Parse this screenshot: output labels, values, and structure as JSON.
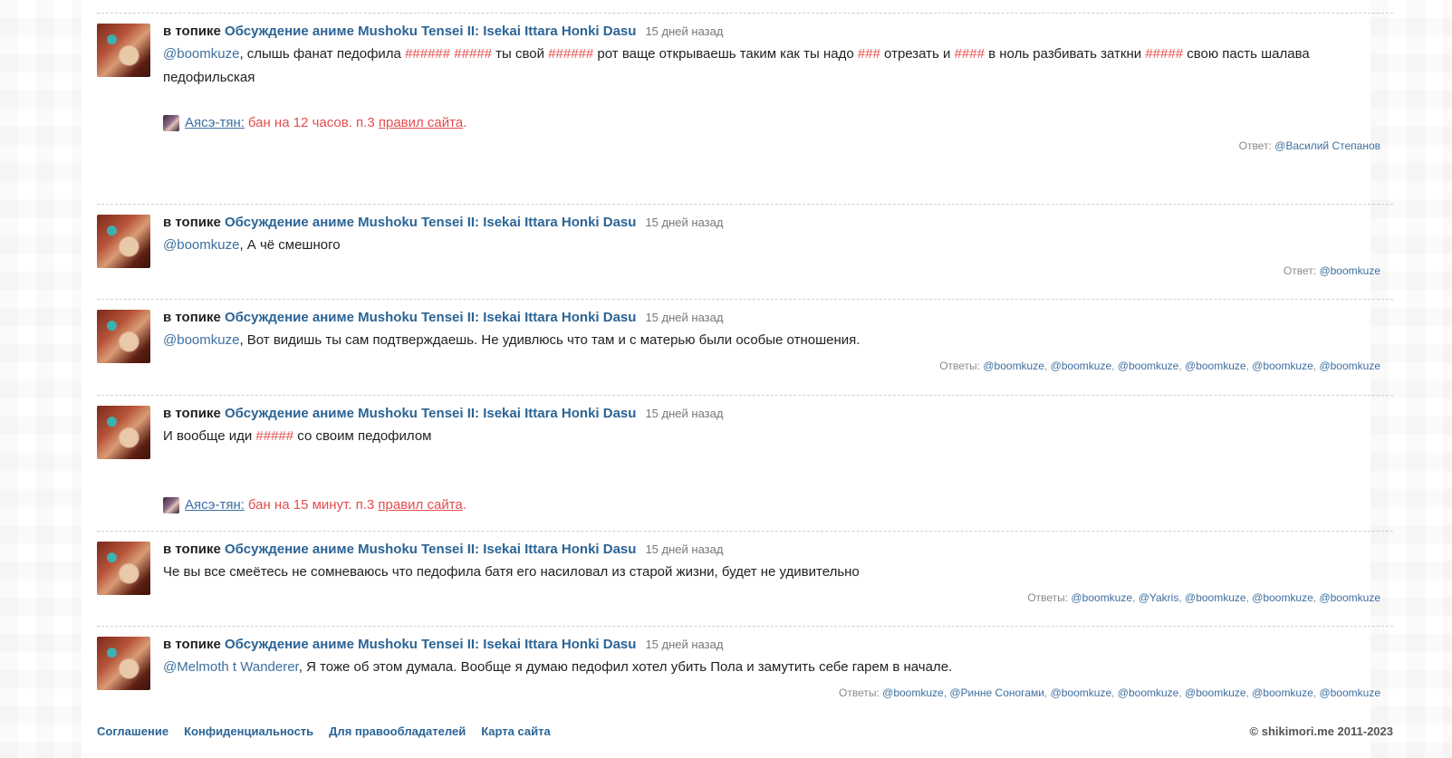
{
  "comments": [
    {
      "in_topic": "в топике",
      "topic": "Обсуждение аниме Mushoku Tensei II: Isekai Ittara Honki Dasu",
      "time": "15 дней назад",
      "parts": [
        {
          "t": "mention",
          "v": "@boomkuze"
        },
        {
          "t": "text",
          "v": ", слышь фанат педофила "
        },
        {
          "t": "censor",
          "v": "######"
        },
        {
          "t": "text",
          "v": " "
        },
        {
          "t": "censor",
          "v": "#####"
        },
        {
          "t": "text",
          "v": " ты свой "
        },
        {
          "t": "censor",
          "v": "######"
        },
        {
          "t": "text",
          "v": " рот ваще открываешь таким как ты надо "
        },
        {
          "t": "censor",
          "v": "###"
        },
        {
          "t": "text",
          "v": " отрезать и "
        },
        {
          "t": "censor",
          "v": "####"
        },
        {
          "t": "text",
          "v": " в ноль разбивать заткни "
        },
        {
          "t": "censor",
          "v": "#####"
        },
        {
          "t": "text",
          "v": " свою пасть шалава педофильская"
        }
      ],
      "ban": {
        "moderator": "Аясэ-тян:",
        "text": "бан на 12 часов. п.3 ",
        "link": "правил сайта",
        "end": "."
      },
      "replies_label": "Ответ:",
      "replies": [
        "@Василий Степанов"
      ]
    },
    {
      "in_topic": "в топике",
      "topic": "Обсуждение аниме Mushoku Tensei II: Isekai Ittara Honki Dasu",
      "time": "15 дней назад",
      "parts": [
        {
          "t": "mention",
          "v": "@boomkuze"
        },
        {
          "t": "text",
          "v": ", А чё смешного"
        }
      ],
      "replies_label": "Ответ:",
      "replies": [
        "@boomkuze"
      ]
    },
    {
      "in_topic": "в топике",
      "topic": "Обсуждение аниме Mushoku Tensei II: Isekai Ittara Honki Dasu",
      "time": "15 дней назад",
      "parts": [
        {
          "t": "mention",
          "v": "@boomkuze"
        },
        {
          "t": "text",
          "v": ", Вот видишь ты сам подтверждаешь. Не удивлюсь что там и с матерью были особые отношения."
        }
      ],
      "replies_label": "Ответы:",
      "replies": [
        "@boomkuze",
        "@boomkuze",
        "@boomkuze",
        "@boomkuze",
        "@boomkuze",
        "@boomkuze"
      ]
    },
    {
      "in_topic": "в топике",
      "topic": "Обсуждение аниме Mushoku Tensei II: Isekai Ittara Honki Dasu",
      "time": "15 дней назад",
      "parts": [
        {
          "t": "text",
          "v": "И вообще иди "
        },
        {
          "t": "censor",
          "v": "#####"
        },
        {
          "t": "text",
          "v": " со своим педофилом"
        }
      ],
      "ban": {
        "moderator": "Аясэ-тян:",
        "text": "бан на 15 минут. п.3 ",
        "link": "правил сайта",
        "end": "."
      },
      "replies_label": "",
      "replies": []
    },
    {
      "in_topic": "в топике",
      "topic": "Обсуждение аниме Mushoku Tensei II: Isekai Ittara Honki Dasu",
      "time": "15 дней назад",
      "parts": [
        {
          "t": "text",
          "v": "Че вы все смеётесь не сомневаюсь что педофила батя его насиловал из старой жизни, будет не удивительно"
        }
      ],
      "replies_label": "Ответы:",
      "replies": [
        "@boomkuze",
        "@Yakris",
        "@boomkuze",
        "@boomkuze",
        "@boomkuze"
      ]
    },
    {
      "in_topic": "в топике",
      "topic": "Обсуждение аниме Mushoku Tensei II: Isekai Ittara Honki Dasu",
      "time": "15 дней назад",
      "parts": [
        {
          "t": "mention",
          "v": "@Melmoth t Wanderer"
        },
        {
          "t": "text",
          "v": ", Я тоже об этом думала. Вообще я думаю педофил хотел убить Пола и замутить себе гарем в начале."
        }
      ],
      "replies_label": "Ответы:",
      "replies": [
        "@boomkuze",
        "@Ринне Соногами",
        "@boomkuze",
        "@boomkuze",
        "@boomkuze",
        "@boomkuze",
        "@boomkuze"
      ]
    }
  ],
  "footer": {
    "links": [
      "Соглашение",
      "Конфиденциальность",
      "Для правообладателей",
      "Карта сайта"
    ],
    "copyright": "© shikimori.me 2011-2023"
  },
  "colors": {
    "link": "#2a6496",
    "mention": "#3d6fa0",
    "censor": "#e34d4d"
  }
}
